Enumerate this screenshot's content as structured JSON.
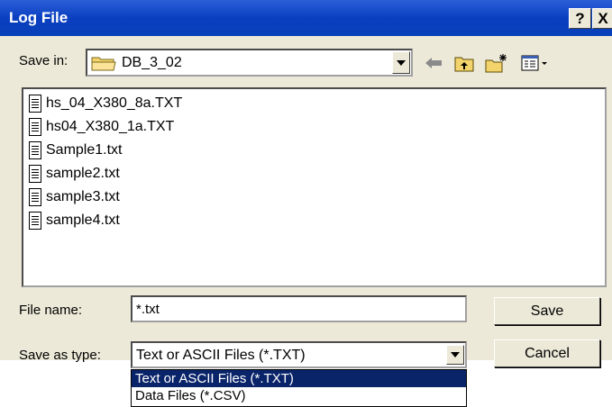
{
  "window": {
    "title": "Log File",
    "help_label": "?",
    "close_label": "X"
  },
  "save_in": {
    "label": "Save in:",
    "value": "DB_3_02"
  },
  "toolbar": {
    "icons": [
      "back-arrow-icon",
      "up-folder-icon",
      "new-folder-icon",
      "view-menu-icon"
    ]
  },
  "files": [
    {
      "name": "hs_04_X380_8a.TXT"
    },
    {
      "name": "hs04_X380_1a.TXT"
    },
    {
      "name": "Sample1.txt"
    },
    {
      "name": "sample2.txt"
    },
    {
      "name": "sample3.txt"
    },
    {
      "name": "sample4.txt"
    }
  ],
  "file_name": {
    "label": "File name:",
    "value": "*.txt"
  },
  "save_as_type": {
    "label": "Save as type:",
    "value": "Text or ASCII Files (*.TXT)",
    "options": [
      {
        "label": "Text or ASCII Files (*.TXT)",
        "selected": true
      },
      {
        "label": "Data Files (*.CSV)",
        "selected": false
      }
    ]
  },
  "buttons": {
    "save": "Save",
    "cancel": "Cancel"
  },
  "colors": {
    "title_bar": "#0a3fc0",
    "dialog_bg": "#ece9d8",
    "selection": "#0a246a"
  }
}
